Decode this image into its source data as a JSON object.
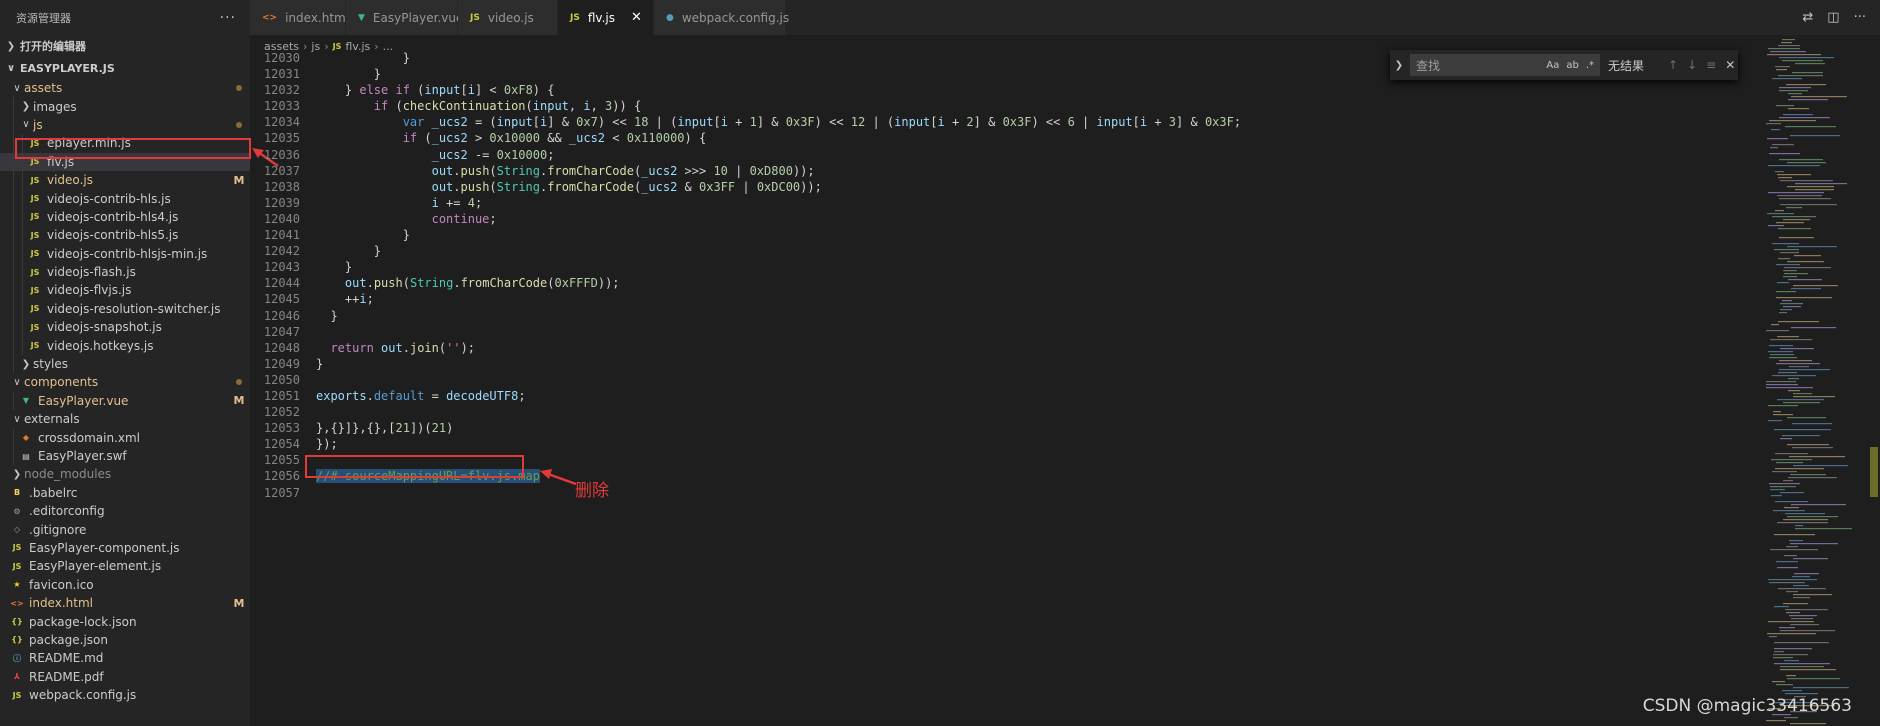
{
  "sidebar": {
    "title": "资源管理器",
    "more": "···",
    "open_editors": "打开的编辑器",
    "project": "EASYPLAYER.JS",
    "items": [
      {
        "label": "assets",
        "type": "folder-open",
        "depth": 1,
        "status": "dot",
        "mod": true
      },
      {
        "label": "images",
        "type": "folder-closed",
        "depth": 2
      },
      {
        "label": "js",
        "type": "folder-open",
        "depth": 2,
        "status": "dot",
        "mod": true
      },
      {
        "label": "eplayer.min.js",
        "type": "js",
        "depth": 3
      },
      {
        "label": "flv.js",
        "type": "js",
        "depth": 3,
        "selected": true
      },
      {
        "label": "video.js",
        "type": "js",
        "depth": 3,
        "status": "M",
        "mod": true
      },
      {
        "label": "videojs-contrib-hls.js",
        "type": "js",
        "depth": 3
      },
      {
        "label": "videojs-contrib-hls4.js",
        "type": "js",
        "depth": 3
      },
      {
        "label": "videojs-contrib-hls5.js",
        "type": "js",
        "depth": 3
      },
      {
        "label": "videojs-contrib-hlsjs-min.js",
        "type": "js",
        "depth": 3
      },
      {
        "label": "videojs-flash.js",
        "type": "js",
        "depth": 3
      },
      {
        "label": "videojs-flvjs.js",
        "type": "js",
        "depth": 3
      },
      {
        "label": "videojs-resolution-switcher.js",
        "type": "js",
        "depth": 3
      },
      {
        "label": "videojs-snapshot.js",
        "type": "js",
        "depth": 3
      },
      {
        "label": "videojs.hotkeys.js",
        "type": "js",
        "depth": 3
      },
      {
        "label": "styles",
        "type": "folder-closed",
        "depth": 2
      },
      {
        "label": "components",
        "type": "folder-open",
        "depth": 1,
        "status": "dot",
        "mod": true
      },
      {
        "label": "EasyPlayer.vue",
        "type": "vue",
        "depth": 2,
        "status": "M",
        "mod": true
      },
      {
        "label": "externals",
        "type": "folder-open",
        "depth": 1
      },
      {
        "label": "crossdomain.xml",
        "type": "xml",
        "depth": 2
      },
      {
        "label": "EasyPlayer.swf",
        "type": "swf",
        "depth": 2
      },
      {
        "label": "node_modules",
        "type": "folder-closed",
        "depth": 1,
        "dim": true
      },
      {
        "label": ".babelrc",
        "type": "babel",
        "depth": 1
      },
      {
        "label": ".editorconfig",
        "type": "gear",
        "depth": 1
      },
      {
        "label": ".gitignore",
        "type": "git",
        "depth": 1
      },
      {
        "label": "EasyPlayer-component.js",
        "type": "js",
        "depth": 1
      },
      {
        "label": "EasyPlayer-element.js",
        "type": "js",
        "depth": 1
      },
      {
        "label": "favicon.ico",
        "type": "star",
        "depth": 1
      },
      {
        "label": "index.html",
        "type": "html",
        "depth": 1,
        "status": "M",
        "mod": true
      },
      {
        "label": "package-lock.json",
        "type": "json",
        "depth": 1
      },
      {
        "label": "package.json",
        "type": "json",
        "depth": 1
      },
      {
        "label": "README.md",
        "type": "md",
        "depth": 1
      },
      {
        "label": "README.pdf",
        "type": "pdf",
        "depth": 1
      },
      {
        "label": "webpack.config.js",
        "type": "js",
        "depth": 1
      }
    ]
  },
  "tabs": [
    {
      "label": "index.html",
      "icon": "html"
    },
    {
      "label": "EasyPlayer.vue",
      "icon": "vue"
    },
    {
      "label": "video.js",
      "icon": "js"
    },
    {
      "label": "flv.js",
      "icon": "js",
      "active": true
    },
    {
      "label": "webpack.config.js",
      "icon": "webpack"
    }
  ],
  "breadcrumb": {
    "p1": "assets",
    "p2": "js",
    "p3": "flv.js",
    "p4": "..."
  },
  "find": {
    "placeholder": "查找",
    "opt_case": "Aa",
    "opt_word": "ab",
    "opt_regex": ".*",
    "result": "无结果"
  },
  "code_lines": [
    {
      "n": "12030",
      "html": "            }"
    },
    {
      "n": "12031",
      "html": "        }"
    },
    {
      "n": "12032",
      "html": "    } <span class='kw'>else if</span> (<span class='var'>input</span>[<span class='var'>i</span>] &lt; <span class='num'>0xF8</span>) {"
    },
    {
      "n": "12033",
      "html": "        <span class='kw'>if</span> (<span class='fn'>checkContinuation</span>(<span class='var'>input</span>, <span class='var'>i</span>, <span class='num'>3</span>)) {"
    },
    {
      "n": "12034",
      "html": "            <span class='kw2'>var</span> <span class='var'>_ucs2</span> = (<span class='var'>input</span>[<span class='var'>i</span>] &amp; <span class='num'>0x7</span>) &lt;&lt; <span class='num'>18</span> | (<span class='var'>input</span>[<span class='var'>i</span> + <span class='num'>1</span>] &amp; <span class='num'>0x3F</span>) &lt;&lt; <span class='num'>12</span> | (<span class='var'>input</span>[<span class='var'>i</span> + <span class='num'>2</span>] &amp; <span class='num'>0x3F</span>) &lt;&lt; <span class='num'>6</span> | <span class='var'>input</span>[<span class='var'>i</span> + <span class='num'>3</span>] &amp; <span class='num'>0x3F</span>;"
    },
    {
      "n": "12035",
      "html": "            <span class='kw'>if</span> (<span class='var'>_ucs2</span> &gt; <span class='num'>0x10000</span> &amp;&amp; <span class='var'>_ucs2</span> &lt; <span class='num'>0x110000</span>) {"
    },
    {
      "n": "12036",
      "html": "                <span class='var'>_ucs2</span> -= <span class='num'>0x10000</span>;"
    },
    {
      "n": "12037",
      "html": "                <span class='var'>out</span>.<span class='fn'>push</span>(<span class='cls'>String</span>.<span class='fn'>fromCharCode</span>(<span class='var'>_ucs2</span> &gt;&gt;&gt; <span class='num'>10</span> | <span class='num'>0xD800</span>));"
    },
    {
      "n": "12038",
      "html": "                <span class='var'>out</span>.<span class='fn'>push</span>(<span class='cls'>String</span>.<span class='fn'>fromCharCode</span>(<span class='var'>_ucs2</span> &amp; <span class='num'>0x3FF</span> | <span class='num'>0xDC00</span>));"
    },
    {
      "n": "12039",
      "html": "                <span class='var'>i</span> += <span class='num'>4</span>;"
    },
    {
      "n": "12040",
      "html": "                <span class='kw'>continue</span>;"
    },
    {
      "n": "12041",
      "html": "            }"
    },
    {
      "n": "12042",
      "html": "        }"
    },
    {
      "n": "12043",
      "html": "    }"
    },
    {
      "n": "12044",
      "html": "    <span class='var'>out</span>.<span class='fn'>push</span>(<span class='cls'>String</span>.<span class='fn'>fromCharCode</span>(<span class='num'>0xFFFD</span>));"
    },
    {
      "n": "12045",
      "html": "    ++<span class='var'>i</span>;"
    },
    {
      "n": "12046",
      "html": "  }"
    },
    {
      "n": "12047",
      "html": ""
    },
    {
      "n": "12048",
      "html": "  <span class='kw'>return</span> <span class='var'>out</span>.<span class='fn'>join</span>(<span class='str'>''</span>);"
    },
    {
      "n": "12049",
      "html": "}"
    },
    {
      "n": "12050",
      "html": ""
    },
    {
      "n": "12051",
      "html": "<span class='var'>exports</span>.<span class='kw2'>default</span> = <span class='var'>decodeUTF8</span>;"
    },
    {
      "n": "12052",
      "html": ""
    },
    {
      "n": "12053",
      "html": "},{}]},{},[<span class='num'>21</span>])(<span class='num'>21</span>)"
    },
    {
      "n": "12054",
      "html": "});"
    },
    {
      "n": "12055",
      "html": ""
    },
    {
      "n": "12056",
      "html": "<span class='hl cmt'>//# sourceMappingURL=flv.js.map</span>"
    },
    {
      "n": "12057",
      "html": ""
    }
  ],
  "annotation": {
    "text": "删除"
  },
  "watermark": "CSDN @magic33416563",
  "colors": {
    "annotation_red": "#e03a3a",
    "editor_bg": "#1e1e1e",
    "sidebar_bg": "#252526"
  }
}
